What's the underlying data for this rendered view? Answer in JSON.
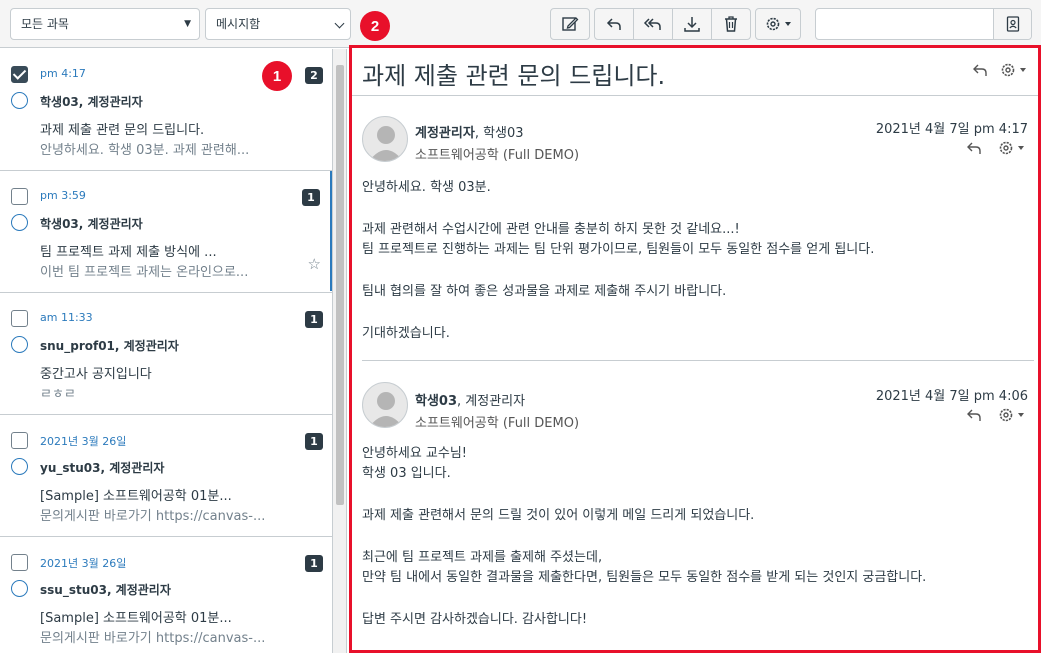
{
  "toolbar": {
    "course_filter": "모든 과목",
    "folder_filter": "메시지함",
    "search_value": ""
  },
  "callouts": [
    "1",
    "2"
  ],
  "conversations": [
    {
      "date": "pm 4:17",
      "participants": "학생03, 계정관리자",
      "subject": "과제 제출 관련 문의 드립니다.",
      "preview": "안녕하세요. 학생 03분. 과제 관련해...",
      "count": "2",
      "checked": true
    },
    {
      "date": "pm 3:59",
      "participants": "학생03, 계정관리자",
      "subject": "팀 프로젝트 과제 제출 방식에 ...",
      "preview": "이번 팀 프로젝트 과제는 온라인으로...",
      "count": "1",
      "checked": false
    },
    {
      "date": "am 11:33",
      "participants": "snu_prof01, 계정관리자",
      "subject": "중간고사 공지입니다",
      "preview": "ㄹㅎㄹ",
      "count": "1",
      "checked": false
    },
    {
      "date": "2021년 3월 26일",
      "participants": "yu_stu03, 계정관리자",
      "subject": "[Sample] 소프트웨어공학 01분...",
      "preview": "문의게시판 바로가기 https://canvas-...",
      "count": "1",
      "checked": false
    },
    {
      "date": "2021년 3월 26일",
      "participants": "ssu_stu03, 계정관리자",
      "subject": "[Sample] 소프트웨어공학 01분...",
      "preview": "문의게시판 바로가기 https://canvas-...",
      "count": "1",
      "checked": false
    }
  ],
  "thread": {
    "title": "과제 제출 관련 문의 드립니다.",
    "messages": [
      {
        "author": "계정관리자",
        "others": ", 학생03",
        "course": "소프트웨어공학 (Full DEMO)",
        "date": "2021년 4월 7일 pm 4:17",
        "lines": [
          "안녕하세요. 학생 03분.",
          "",
          "과제 관련해서 수업시간에 관련 안내를 충분히 하지 못한 것 같네요...!",
          "팀 프로젝트로 진행하는 과제는 팀 단위 평가이므로, 팀원들이 모두 동일한 점수를 얻게 됩니다.",
          "",
          "팀내 협의를 잘 하여 좋은 성과물을 과제로 제출해 주시기 바랍니다.",
          "",
          "기대하겠습니다."
        ]
      },
      {
        "author": "학생03",
        "others": ", 계정관리자",
        "course": "소프트웨어공학 (Full DEMO)",
        "date": "2021년 4월 7일 pm 4:06",
        "lines": [
          "안녕하세요 교수님!",
          "학생 03 입니다.",
          "",
          "과제 제출 관련해서 문의 드릴 것이 있어 이렇게 메일 드리게 되었습니다.",
          "",
          "최근에 팀 프로젝트 과제를 출제해 주셨는데,",
          "만약 팀 내에서 동일한 결과물을 제출한다면, 팀원들은 모두 동일한 점수를 받게 되는 것인지 궁금합니다.",
          "",
          "답변 주시면 감사하겠습니다. 감사합니다!"
        ]
      }
    ]
  },
  "colors": {
    "accent": "#2b7abc",
    "callout": "#e8102a",
    "text": "#2d3b45"
  }
}
